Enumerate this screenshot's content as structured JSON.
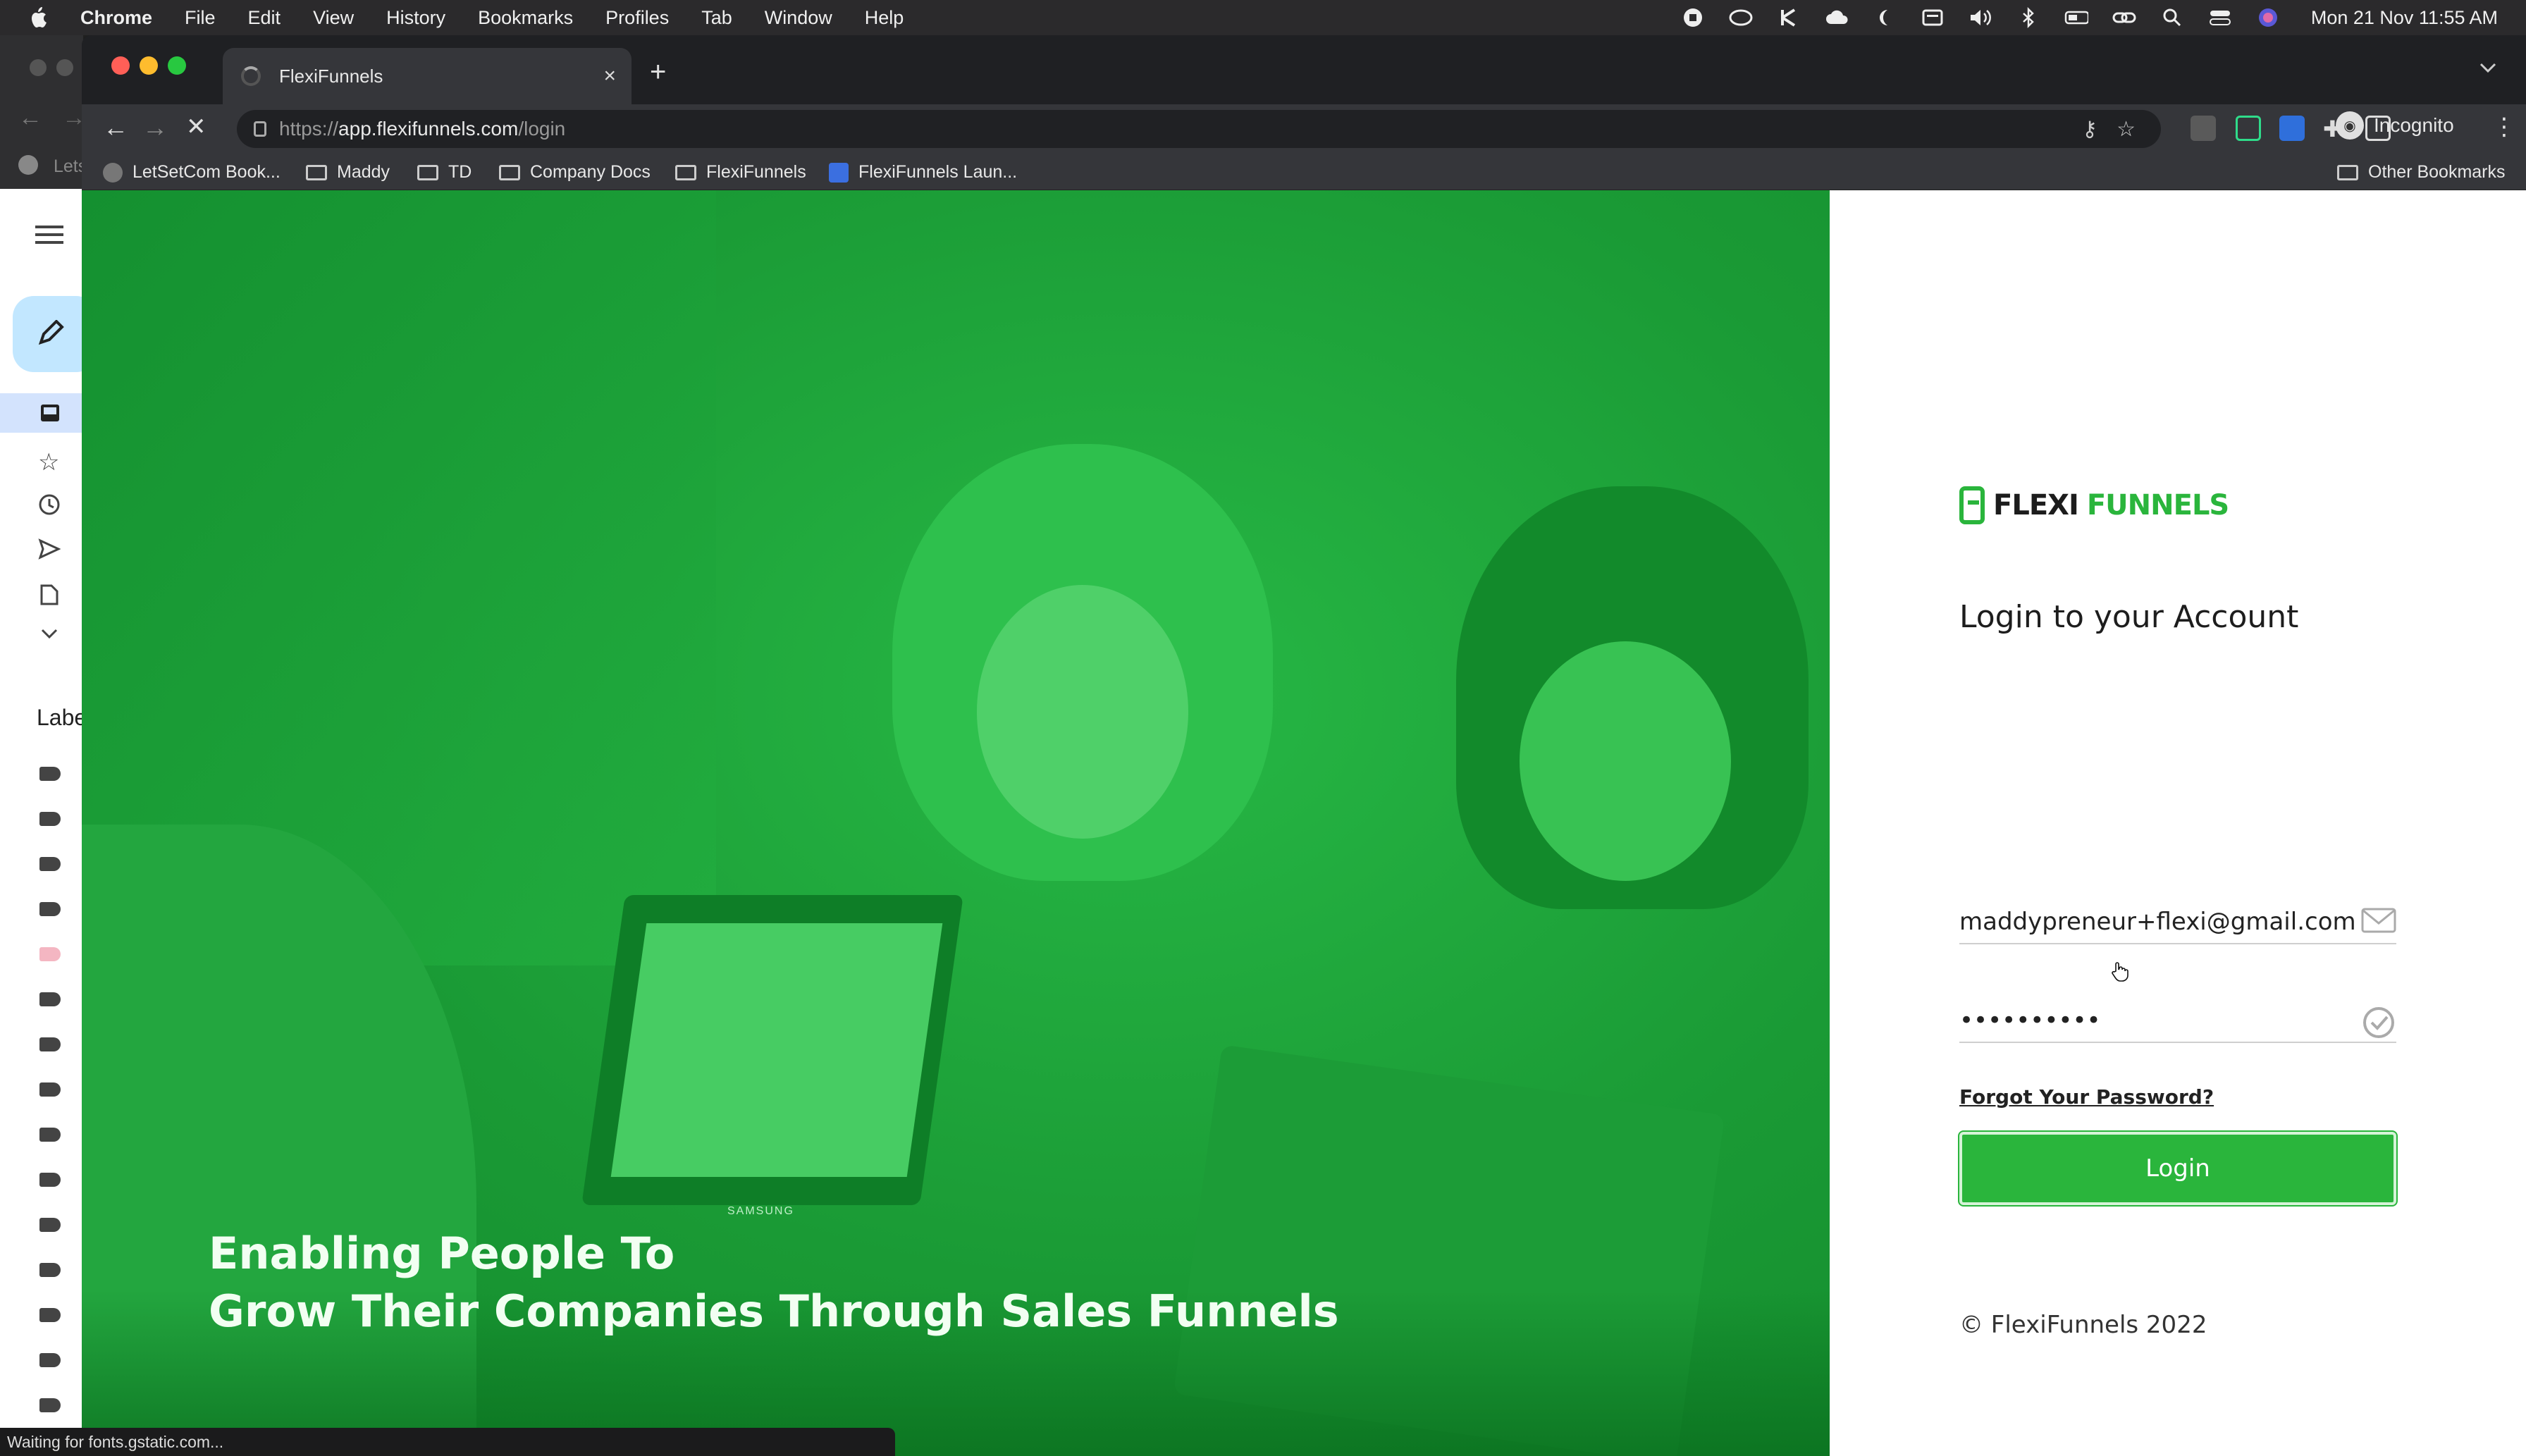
{
  "menubar": {
    "app_name": "Chrome",
    "items": [
      "File",
      "Edit",
      "View",
      "History",
      "Bookmarks",
      "Profiles",
      "Tab",
      "Window",
      "Help"
    ],
    "clock": "Mon 21 Nov  11:55 AM"
  },
  "tab": {
    "title": "FlexiFunnels",
    "close_label": "×",
    "new_tab_label": "+"
  },
  "omnibox": {
    "url_scheme": "https://",
    "url_host": "app.flexifunnels.com",
    "url_path": "/login"
  },
  "incognito_label": "Incognito",
  "bookmarks": {
    "items": [
      "LetSetCom Book...",
      "Maddy",
      "TD",
      "Company Docs",
      "FlexiFunnels",
      "FlexiFunnels Laun..."
    ],
    "other": "Other Bookmarks",
    "back_window_partial": "Lets"
  },
  "gmail_partial": {
    "labels_heading": "Labe"
  },
  "hero": {
    "headline_line1": "Enabling People To",
    "headline_line2": "Grow Their Companies Through Sales Funnels",
    "laptop_brand": "SAMSUNG"
  },
  "login": {
    "logo_word1": "FLEXI",
    "logo_word2": "FUNNELS",
    "title": "Login to your Account",
    "email_value": "maddypreneur+flexi@gmail.com",
    "password_value": "••••••••••",
    "forgot_label": "Forgot Your Password?",
    "button_label": "Login",
    "copyright": "© FlexiFunnels 2022"
  },
  "status_text": "Waiting for fonts.gstatic.com...",
  "colors": {
    "brand_green": "#2ab53c",
    "hero_green": "#1fa93b"
  }
}
